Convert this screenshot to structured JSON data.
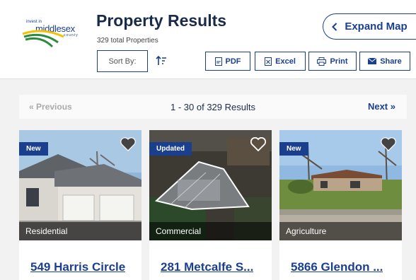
{
  "logo": {
    "small": "invest in",
    "big": "middlesex",
    "county": "county"
  },
  "header": {
    "title": "Property Results",
    "subtitle": "329 total Properties",
    "expand_label": "Expand Map"
  },
  "toolbar": {
    "sort_label": "Sort By:",
    "pdf_label": "PDF",
    "excel_label": "Excel",
    "print_label": "Print",
    "share_label": "Share"
  },
  "pager": {
    "prev_label": "Previous",
    "count_text": "1 - 30 of 329 Results",
    "next_label": "Next"
  },
  "cards": [
    {
      "badge": "New",
      "type": "Residential",
      "address": "549 Harris Circle"
    },
    {
      "badge": "Updated",
      "type": "Commercial",
      "address": "281 Metcalfe S..."
    },
    {
      "badge": "New",
      "type": "Agriculture",
      "address": "5866 Glendon ..."
    }
  ],
  "colors": {
    "brand": "#1b3f8f",
    "title": "#1a2b4a",
    "overlay": "#000000"
  }
}
